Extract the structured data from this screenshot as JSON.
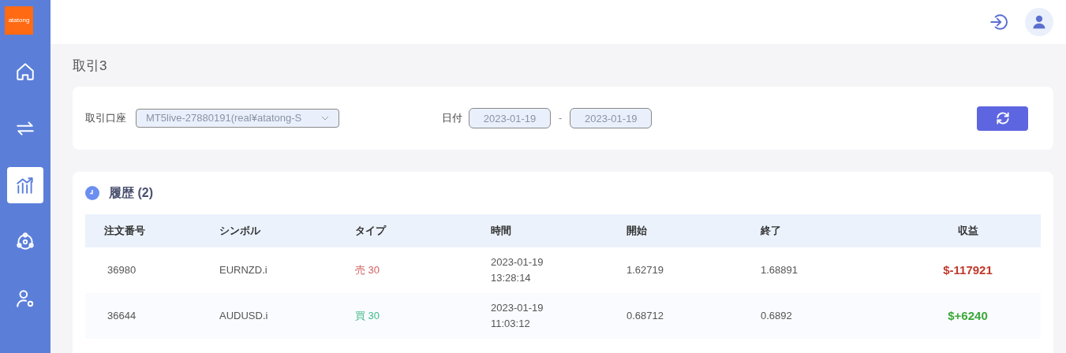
{
  "logo": {
    "text": "atatong"
  },
  "sidebar": {
    "items": [
      {
        "kind": "home",
        "selected": false
      },
      {
        "kind": "transfer",
        "selected": false
      },
      {
        "kind": "chart",
        "selected": true
      },
      {
        "kind": "network",
        "selected": false
      },
      {
        "kind": "account",
        "selected": false
      }
    ]
  },
  "page_title": "取引3",
  "filters": {
    "account_label": "取引口座",
    "account_value": "MT5live-27880191(real¥atatong-S",
    "date_label": "日付",
    "date_from": "2023-01-19",
    "date_separator": "-",
    "date_to": "2023-01-19"
  },
  "history": {
    "title": "履歴 (2)",
    "columns": [
      "注文番号",
      "シンボル",
      "タイプ",
      "時間",
      "開始",
      "終了",
      "収益"
    ],
    "rows": [
      {
        "order": "36980",
        "symbol": "EURNZD.i",
        "type": {
          "text": "売 30",
          "kind": "sell"
        },
        "time": [
          "2023-01-19",
          "13:28:14"
        ],
        "open": "1.62719",
        "close": "1.68891",
        "profit": {
          "text": "$-117921",
          "kind": "loss"
        }
      },
      {
        "order": "36644",
        "symbol": "AUDUSD.i",
        "type": {
          "text": "買 30",
          "kind": "buy"
        },
        "time": [
          "2023-01-19",
          "11:03:12"
        ],
        "open": "0.68712",
        "close": "0.6892",
        "profit": {
          "text": "$+6240",
          "kind": "gain"
        }
      }
    ]
  }
}
